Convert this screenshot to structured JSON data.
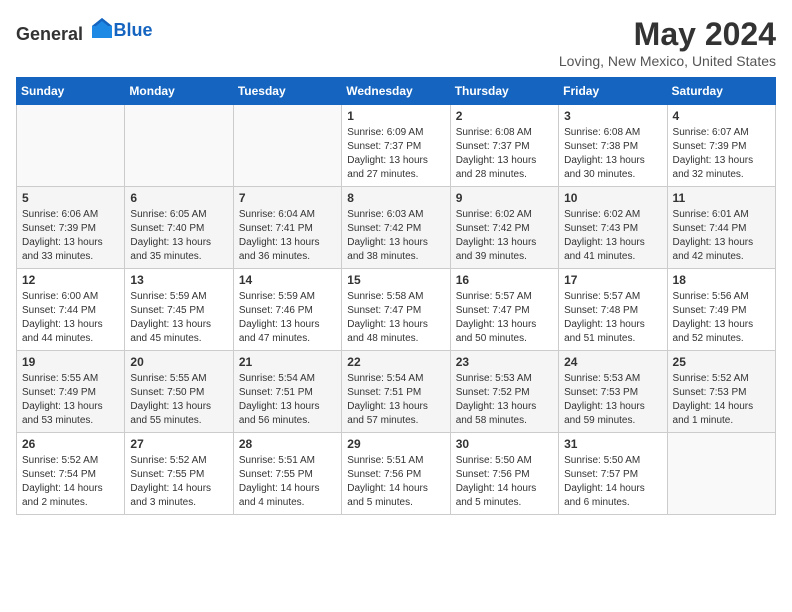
{
  "header": {
    "logo_general": "General",
    "logo_blue": "Blue",
    "month_title": "May 2024",
    "location": "Loving, New Mexico, United States"
  },
  "calendar": {
    "days_of_week": [
      "Sunday",
      "Monday",
      "Tuesday",
      "Wednesday",
      "Thursday",
      "Friday",
      "Saturday"
    ],
    "weeks": [
      [
        {
          "day": "",
          "content": ""
        },
        {
          "day": "",
          "content": ""
        },
        {
          "day": "",
          "content": ""
        },
        {
          "day": "1",
          "content": "Sunrise: 6:09 AM\nSunset: 7:37 PM\nDaylight: 13 hours\nand 27 minutes."
        },
        {
          "day": "2",
          "content": "Sunrise: 6:08 AM\nSunset: 7:37 PM\nDaylight: 13 hours\nand 28 minutes."
        },
        {
          "day": "3",
          "content": "Sunrise: 6:08 AM\nSunset: 7:38 PM\nDaylight: 13 hours\nand 30 minutes."
        },
        {
          "day": "4",
          "content": "Sunrise: 6:07 AM\nSunset: 7:39 PM\nDaylight: 13 hours\nand 32 minutes."
        }
      ],
      [
        {
          "day": "5",
          "content": "Sunrise: 6:06 AM\nSunset: 7:39 PM\nDaylight: 13 hours\nand 33 minutes."
        },
        {
          "day": "6",
          "content": "Sunrise: 6:05 AM\nSunset: 7:40 PM\nDaylight: 13 hours\nand 35 minutes."
        },
        {
          "day": "7",
          "content": "Sunrise: 6:04 AM\nSunset: 7:41 PM\nDaylight: 13 hours\nand 36 minutes."
        },
        {
          "day": "8",
          "content": "Sunrise: 6:03 AM\nSunset: 7:42 PM\nDaylight: 13 hours\nand 38 minutes."
        },
        {
          "day": "9",
          "content": "Sunrise: 6:02 AM\nSunset: 7:42 PM\nDaylight: 13 hours\nand 39 minutes."
        },
        {
          "day": "10",
          "content": "Sunrise: 6:02 AM\nSunset: 7:43 PM\nDaylight: 13 hours\nand 41 minutes."
        },
        {
          "day": "11",
          "content": "Sunrise: 6:01 AM\nSunset: 7:44 PM\nDaylight: 13 hours\nand 42 minutes."
        }
      ],
      [
        {
          "day": "12",
          "content": "Sunrise: 6:00 AM\nSunset: 7:44 PM\nDaylight: 13 hours\nand 44 minutes."
        },
        {
          "day": "13",
          "content": "Sunrise: 5:59 AM\nSunset: 7:45 PM\nDaylight: 13 hours\nand 45 minutes."
        },
        {
          "day": "14",
          "content": "Sunrise: 5:59 AM\nSunset: 7:46 PM\nDaylight: 13 hours\nand 47 minutes."
        },
        {
          "day": "15",
          "content": "Sunrise: 5:58 AM\nSunset: 7:47 PM\nDaylight: 13 hours\nand 48 minutes."
        },
        {
          "day": "16",
          "content": "Sunrise: 5:57 AM\nSunset: 7:47 PM\nDaylight: 13 hours\nand 50 minutes."
        },
        {
          "day": "17",
          "content": "Sunrise: 5:57 AM\nSunset: 7:48 PM\nDaylight: 13 hours\nand 51 minutes."
        },
        {
          "day": "18",
          "content": "Sunrise: 5:56 AM\nSunset: 7:49 PM\nDaylight: 13 hours\nand 52 minutes."
        }
      ],
      [
        {
          "day": "19",
          "content": "Sunrise: 5:55 AM\nSunset: 7:49 PM\nDaylight: 13 hours\nand 53 minutes."
        },
        {
          "day": "20",
          "content": "Sunrise: 5:55 AM\nSunset: 7:50 PM\nDaylight: 13 hours\nand 55 minutes."
        },
        {
          "day": "21",
          "content": "Sunrise: 5:54 AM\nSunset: 7:51 PM\nDaylight: 13 hours\nand 56 minutes."
        },
        {
          "day": "22",
          "content": "Sunrise: 5:54 AM\nSunset: 7:51 PM\nDaylight: 13 hours\nand 57 minutes."
        },
        {
          "day": "23",
          "content": "Sunrise: 5:53 AM\nSunset: 7:52 PM\nDaylight: 13 hours\nand 58 minutes."
        },
        {
          "day": "24",
          "content": "Sunrise: 5:53 AM\nSunset: 7:53 PM\nDaylight: 13 hours\nand 59 minutes."
        },
        {
          "day": "25",
          "content": "Sunrise: 5:52 AM\nSunset: 7:53 PM\nDaylight: 14 hours\nand 1 minute."
        }
      ],
      [
        {
          "day": "26",
          "content": "Sunrise: 5:52 AM\nSunset: 7:54 PM\nDaylight: 14 hours\nand 2 minutes."
        },
        {
          "day": "27",
          "content": "Sunrise: 5:52 AM\nSunset: 7:55 PM\nDaylight: 14 hours\nand 3 minutes."
        },
        {
          "day": "28",
          "content": "Sunrise: 5:51 AM\nSunset: 7:55 PM\nDaylight: 14 hours\nand 4 minutes."
        },
        {
          "day": "29",
          "content": "Sunrise: 5:51 AM\nSunset: 7:56 PM\nDaylight: 14 hours\nand 5 minutes."
        },
        {
          "day": "30",
          "content": "Sunrise: 5:50 AM\nSunset: 7:56 PM\nDaylight: 14 hours\nand 5 minutes."
        },
        {
          "day": "31",
          "content": "Sunrise: 5:50 AM\nSunset: 7:57 PM\nDaylight: 14 hours\nand 6 minutes."
        },
        {
          "day": "",
          "content": ""
        }
      ]
    ]
  }
}
